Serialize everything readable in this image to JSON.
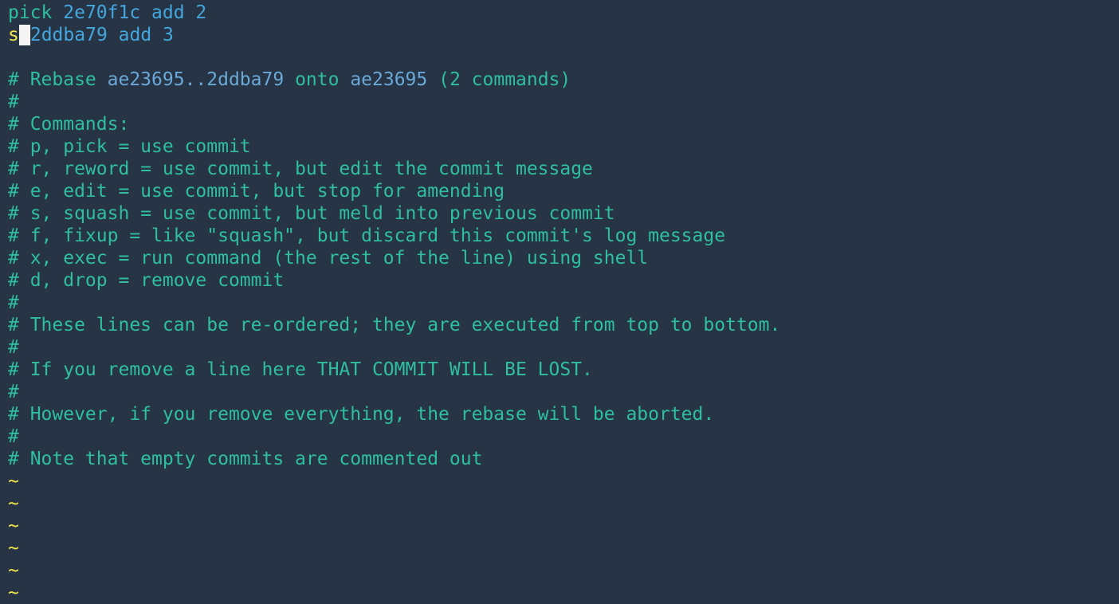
{
  "editor": {
    "todo": [
      {
        "command": "pick",
        "hash": "2e70f1c",
        "message": "add 2"
      },
      {
        "command": "s",
        "hash": "2ddba79",
        "message": "add 3"
      }
    ],
    "rebase_header": {
      "prefix": "# Rebase",
      "range": "ae23695..2ddba79",
      "onto_word": "onto",
      "onto_hash": "ae23695",
      "suffix": "(2 commands)"
    },
    "comments": [
      "#",
      "# Commands:",
      "# p, pick = use commit",
      "# r, reword = use commit, but edit the commit message",
      "# e, edit = use commit, but stop for amending",
      "# s, squash = use commit, but meld into previous commit",
      "# f, fixup = like \"squash\", but discard this commit's log message",
      "# x, exec = run command (the rest of the line) using shell",
      "# d, drop = remove commit",
      "#",
      "# These lines can be re-ordered; they are executed from top to bottom.",
      "#",
      "# If you remove a line here THAT COMMIT WILL BE LOST.",
      "#",
      "# However, if you remove everything, the rebase will be aborted.",
      "#",
      "# Note that empty commits are commented out"
    ],
    "tilde": "~",
    "colors": {
      "background": "#263445",
      "comment": "#2fbf9d",
      "hash": "#43a6dc",
      "edited_command": "#f0e64a",
      "cursor": "#f4f4f4"
    }
  }
}
